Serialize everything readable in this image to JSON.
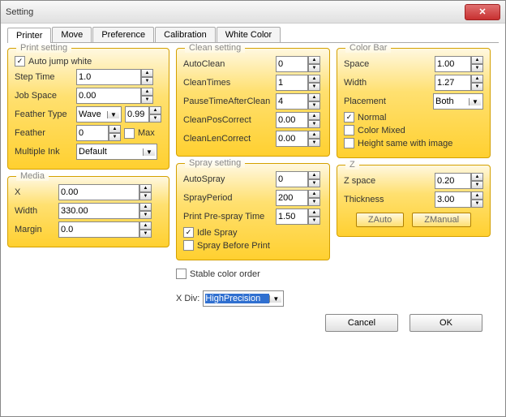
{
  "window": {
    "title": "Setting"
  },
  "tabs": {
    "items": [
      "Printer",
      "Move",
      "Preference",
      "Calibration",
      "White Color"
    ],
    "active": 0
  },
  "printSetting": {
    "legend": "Print setting",
    "autoJumpWhite": {
      "label": "Auto jump white",
      "checked": true
    },
    "stepTime": {
      "label": "Step Time",
      "value": "1.0"
    },
    "jobSpace": {
      "label": "Job Space",
      "value": "0.00"
    },
    "featherType": {
      "label": "Feather Type",
      "value": "Wave",
      "num": "0.99"
    },
    "feather": {
      "label": "Feather",
      "value": "0",
      "max": {
        "label": "Max",
        "checked": false
      }
    },
    "multipleInk": {
      "label": "Multiple Ink",
      "value": "Default"
    }
  },
  "media": {
    "legend": "Media",
    "x": {
      "label": "X",
      "value": "0.00"
    },
    "width": {
      "label": "Width",
      "value": "330.00"
    },
    "margin": {
      "label": "Margin",
      "value": "0.0"
    }
  },
  "cleanSetting": {
    "legend": "Clean setting",
    "autoClean": {
      "label": "AutoClean",
      "value": "0"
    },
    "cleanTimes": {
      "label": "CleanTimes",
      "value": "1"
    },
    "pauseTime": {
      "label": "PauseTimeAfterClean",
      "value": "4"
    },
    "posCorrect": {
      "label": "CleanPosCorrect",
      "value": "0.00"
    },
    "lenCorrect": {
      "label": "CleanLenCorrect",
      "value": "0.00"
    }
  },
  "spraySetting": {
    "legend": "Spray setting",
    "autoSpray": {
      "label": "AutoSpray",
      "value": "0"
    },
    "sprayPeriod": {
      "label": "SprayPeriod",
      "value": "200"
    },
    "preSpray": {
      "label": "Print Pre-spray Time",
      "value": "1.50"
    },
    "idleSpray": {
      "label": "Idle Spray",
      "checked": true
    },
    "sprayBefore": {
      "label": "Spray Before Print",
      "checked": false
    }
  },
  "colorBar": {
    "legend": "Color Bar",
    "space": {
      "label": "Space",
      "value": "1.00"
    },
    "width": {
      "label": "Width",
      "value": "1.27"
    },
    "placement": {
      "label": "Placement",
      "value": "Both"
    },
    "normal": {
      "label": "Normal",
      "checked": true
    },
    "colorMixed": {
      "label": "Color Mixed",
      "checked": false
    },
    "heightSame": {
      "label": "Height same with image",
      "checked": false
    }
  },
  "z": {
    "legend": "Z",
    "zspace": {
      "label": "Z space",
      "value": "0.20"
    },
    "thickness": {
      "label": "Thickness",
      "value": "3.00"
    },
    "zauto": "ZAuto",
    "zmanual": "ZManual"
  },
  "misc": {
    "stableColorOrder": {
      "label": "Stable color order",
      "checked": false
    },
    "xdiv": {
      "label": "X Div:",
      "value": "HighPrecision"
    }
  },
  "buttons": {
    "cancel": "Cancel",
    "ok": "OK"
  }
}
